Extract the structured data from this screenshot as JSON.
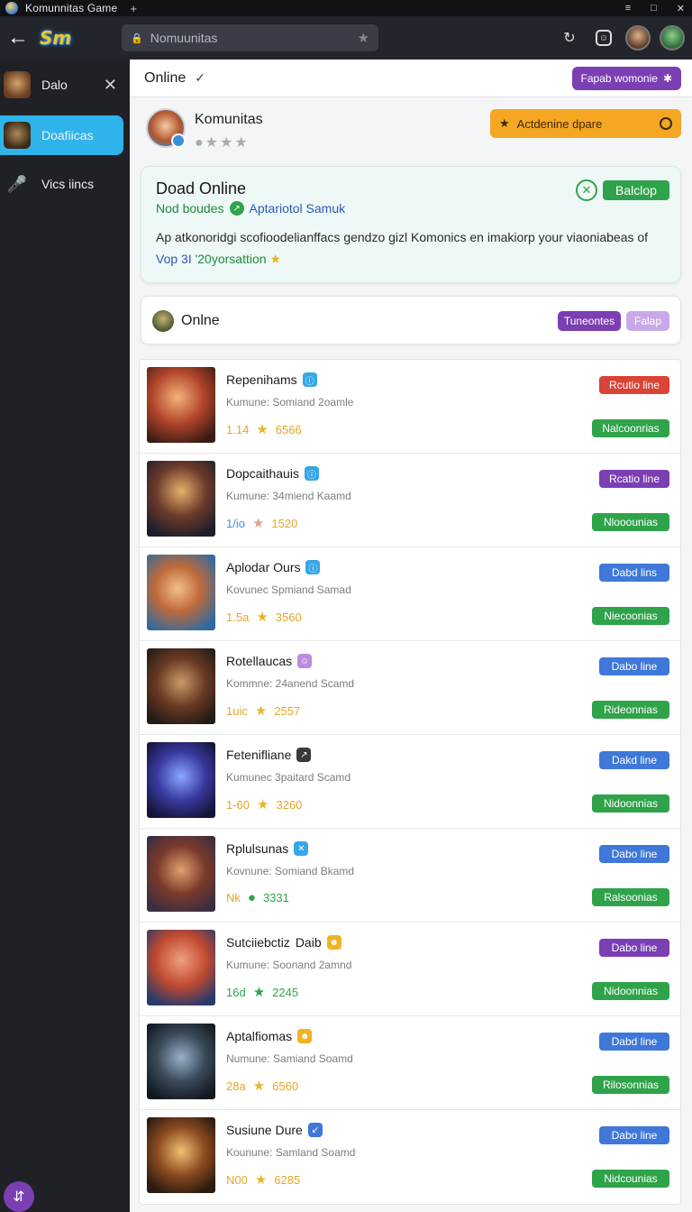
{
  "window": {
    "title": "Komunnitas  Game",
    "plus": "+",
    "controls": [
      "≡",
      "□",
      "✕"
    ]
  },
  "appbar": {
    "back": "←",
    "logo": "Sm",
    "search_text": "Nomuunitas",
    "search_star": "★",
    "reload": "↻"
  },
  "sidebar": {
    "items": [
      {
        "label": "Dalo",
        "close": "✕"
      },
      {
        "label": "Doafiicas"
      },
      {
        "label": "Vics iincs"
      }
    ],
    "fab_icon": "⇵"
  },
  "header": {
    "title": "Online",
    "check": "✓",
    "pill": "Fapab womonie"
  },
  "profile": {
    "name": "Komunitas",
    "stars": "●★★★",
    "cta": "Actdenine dpare"
  },
  "online_card": {
    "title": "Doad Online",
    "sub_left": "Nod boudes",
    "sub_right": "Aptariotol Samuk",
    "desc_line1": "Ap atkonoridgi scofioodelianffacs gendzo gizl Komonics en imakiorp your viaoniabeas of",
    "desc_accent": "Vop 3I",
    "desc_green": "'20yorsattion",
    "desc_star": "★",
    "button": "Balclop"
  },
  "tabs_card": {
    "label": "Onlne",
    "tab1": "Tuneontes",
    "tab2": "Falap"
  },
  "colors": {
    "red": "#d94436",
    "purple": "#7b3fb3",
    "blue": "#3f78d9",
    "green": "#2fa34a",
    "orange": "#e6a525"
  },
  "rows": [
    {
      "name": "Repenihams",
      "icon": "ⓘ",
      "icon_color": "#35a7e6",
      "sub": "Kumune: Somiand 2oamle",
      "rating": "1.14",
      "star": "★",
      "star_color": "#e9b52a",
      "rating_color": "#e6a525",
      "count": "6566",
      "count_color": "#e6a525",
      "badge1": "Rcutio line",
      "badge1_color": "#d94436",
      "badge2": "Nalcoonrias"
    },
    {
      "name": "Dopcaithauis",
      "icon": "ⓘ",
      "icon_color": "#35a7e6",
      "sub": "Kumune: 34miend Kaamd",
      "rating": "1/io",
      "star": "★",
      "star_color": "#e6a08a",
      "rating_color": "#3f8fdc",
      "count": "1520",
      "count_color": "#e6a525",
      "badge1": "Rcatio line",
      "badge1_color": "#7b3fb3",
      "badge2": "Nlooounias"
    },
    {
      "name": "Aplodar Ours",
      "icon": "ⓘ",
      "icon_color": "#35a7e6",
      "sub": "Kovunec Spmiand Samad",
      "rating": "1.5a",
      "star": "★",
      "star_color": "#e9b52a",
      "rating_color": "#e6a525",
      "count": "3560",
      "count_color": "#e6a525",
      "badge1": "Dabd lins",
      "badge1_color": "#3f78d9",
      "badge2": "Niecoonias"
    },
    {
      "name": "Rotellaucas",
      "icon": "☺",
      "icon_color": "#b98ae0",
      "sub": "Kommne: 24anend Scamd",
      "rating": "1uic",
      "star": "★",
      "star_color": "#e9b52a",
      "rating_color": "#e6a525",
      "count": "2557",
      "count_color": "#e6a525",
      "badge1": "Dabo line",
      "badge1_color": "#3f78d9",
      "badge2": "Rideonnias"
    },
    {
      "name": "Fetenifliane",
      "icon": "↗",
      "icon_color": "#3a3a3a",
      "sub": "Kumunec 3paitard Scamd",
      "rating": "1-60",
      "star": "★",
      "star_color": "#e9b52a",
      "rating_color": "#e6a525",
      "count": "3260",
      "count_color": "#e6a525",
      "badge1": "Dakd line",
      "badge1_color": "#3f78d9",
      "badge2": "Nidoonnias"
    },
    {
      "name": "Rplulsunas",
      "icon": "✕",
      "icon_color": "#35a7e6",
      "sub": "Kovnune: Somiand Bkamd",
      "rating": "Nk",
      "star": "●",
      "star_color": "#2fa34a",
      "rating_color": "#e6a525",
      "count": "3331",
      "count_color": "#2fa34a",
      "badge1": "Dabo line",
      "badge1_color": "#3f78d9",
      "badge2": "Ralsoonias"
    },
    {
      "name": "Sutciiebctiz",
      "name_extra": "Daib",
      "icon": "☻",
      "icon_color": "#f0b323",
      "sub": "Kumune: Soonand 2amnd",
      "rating": "16d",
      "star": "★",
      "star_color": "#2fa34a",
      "rating_color": "#2fa34a",
      "count": "2245",
      "count_color": "#2fa34a",
      "badge1": "Dabo line",
      "badge1_color": "#7b3fb3",
      "badge2": "Nidoonnias"
    },
    {
      "name": "Aptalfiomas",
      "icon": "☻",
      "icon_color": "#f0b323",
      "sub": "Numune: Samiand Soamd",
      "rating": "28a",
      "star": "★",
      "star_color": "#e9b52a",
      "rating_color": "#e6a525",
      "count": "6560",
      "count_color": "#e6a525",
      "badge1": "Dabd line",
      "badge1_color": "#3f78d9",
      "badge2": "Rilosonnias"
    },
    {
      "name": "Susiune Dure",
      "icon": "↙",
      "icon_color": "#3f78d9",
      "sub": "Kounune: Samland Soamd",
      "rating": "N00",
      "star": "★",
      "star_color": "#e9b52a",
      "rating_color": "#e6a525",
      "count": "6285",
      "count_color": "#e6a525",
      "badge1": "Dabo line",
      "badge1_color": "#3f78d9",
      "badge2": "Nidcounias"
    }
  ]
}
